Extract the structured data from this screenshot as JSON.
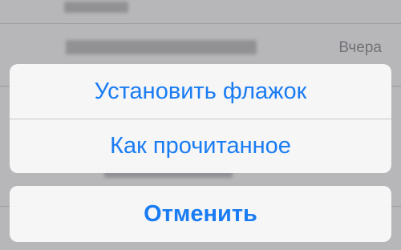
{
  "mail_list": {
    "rows": [
      {
        "date": ""
      },
      {
        "date": "Вчера"
      },
      {
        "date": ""
      }
    ]
  },
  "action_sheet": {
    "options": [
      {
        "label": "Установить флажок"
      },
      {
        "label": "Как прочитанное"
      }
    ],
    "cancel_label": "Отменить"
  },
  "colors": {
    "action_tint": "#1a7cf2",
    "sheet_background": "#f8f8f9",
    "date_text": "#8e8e93"
  }
}
